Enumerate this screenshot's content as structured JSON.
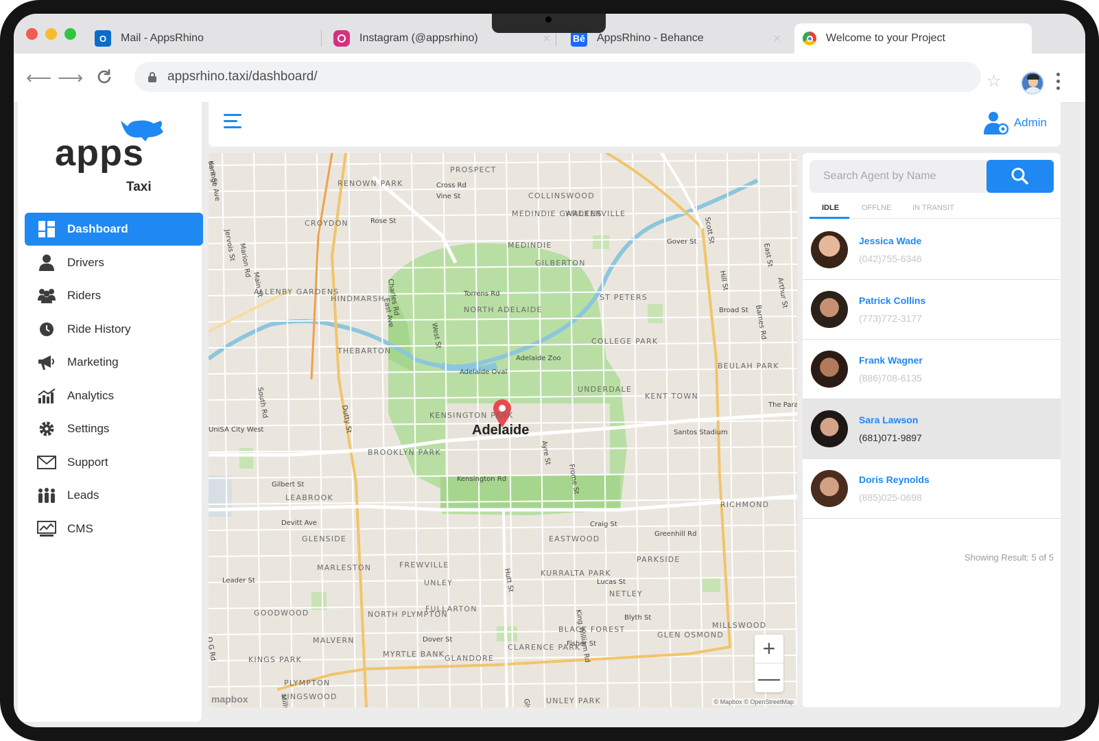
{
  "browser": {
    "tabs": [
      {
        "label": "Mail - AppsRhino",
        "icon": "outlook-icon"
      },
      {
        "label": "Instagram (@appsrhino)",
        "icon": "instagram-icon"
      },
      {
        "label": "AppsRhino - Behance",
        "icon": "behance-icon"
      },
      {
        "label": "Welcome to your Project",
        "icon": "chrome-icon"
      }
    ],
    "url": "appsrhino.taxi/dashboard/"
  },
  "brand": {
    "name": "apps",
    "product": "Taxi",
    "color": "#1f88f2"
  },
  "sidebar": {
    "items": [
      {
        "label": "Dashboard",
        "icon": "dashboard-icon",
        "active": true
      },
      {
        "label": "Drivers",
        "icon": "driver-icon"
      },
      {
        "label": "Riders",
        "icon": "riders-icon"
      },
      {
        "label": "Ride History",
        "icon": "clock-icon"
      },
      {
        "label": "Marketing",
        "icon": "megaphone-icon"
      },
      {
        "label": "Analytics",
        "icon": "analytics-icon"
      },
      {
        "label": "Settings",
        "icon": "gear-icon"
      },
      {
        "label": "Support",
        "icon": "mail-icon"
      },
      {
        "label": "Leads",
        "icon": "leads-icon"
      },
      {
        "label": "CMS",
        "icon": "cms-icon"
      }
    ]
  },
  "header": {
    "user_label": "Admin"
  },
  "map": {
    "city": "Adelaide",
    "attribution": "© Mapbox © OpenStreetMap",
    "provider": "mapbox",
    "labels": [
      "PROSPECT",
      "RENOWN PARK",
      "COLLINSWOOD",
      "CROYDON",
      "MEDINDIE GARDENS",
      "WALKERVILLE",
      "MEDINDIE",
      "GILBERTON",
      "ALLENBY GARDENS",
      "HINDMARSH",
      "NORTH ADELAIDE",
      "ST PETERS",
      "THEBARTON",
      "COLLEGE PARK",
      "Adelaide Zoo",
      "Adelaide Oval",
      "BEULAH PARK",
      "UNDERDALE",
      "KENT TOWN",
      "The Parade",
      "KENSINGTON PARK",
      "UniSA City West",
      "BROOKLYN PARK",
      "Santos Stadium",
      "Kensington Rd",
      "LEABROOK",
      "Gilbert St",
      "RICHMOND",
      "Craig St",
      "Greenhill Rd",
      "EASTWOOD",
      "GLENSIDE",
      "PARKSIDE",
      "MARLESTON",
      "FREWVILLE",
      "KURRALTA PARK",
      "Leader St",
      "UNLEY",
      "NETLEY",
      "GOODWOOD",
      "FULLARTON",
      "NORTH PLYMPTON",
      "MILLSWOOD",
      "BLACK FOREST",
      "GLEN OSMOND",
      "MALVERN",
      "MYRTLE BANK",
      "GLANDORE",
      "CLARENCE PARK",
      "KINGS PARK",
      "UNLEY PARK",
      "PLYMPTON",
      "KINGSWOOD",
      "Cross Rd",
      "Vine St",
      "Rose St",
      "Torrens Rd",
      "Gover St",
      "Broad St",
      "Devitt Ave",
      "Lucas St",
      "Blyth St",
      "Fisher St",
      "Dover St",
      "Mills St",
      "Ayre St",
      "Frome St",
      "Hutt St",
      "King William Rd",
      "Dutty St",
      "South Rd",
      "Marion Rd",
      "Jervois St",
      "Main St",
      "Charles Rd",
      "East Ave",
      "West St",
      "East St",
      "Hill St",
      "Barnes Rd",
      "Arthur St",
      "Gage St",
      "Scott St",
      "Glynburn Rd",
      "O G Rd",
      "Kent St",
      "oaringe Ave"
    ]
  },
  "agents": {
    "search_placeholder": "Search Agent by Name",
    "tabs": [
      "IDLE",
      "OFFLNE",
      "IN TRANSIT"
    ],
    "list": [
      {
        "name": "Jessica Wade",
        "phone": "(042)755-6346"
      },
      {
        "name": "Patrick Collins",
        "phone": "(773)772-3177"
      },
      {
        "name": "Frank Wagner",
        "phone": "(886)708-6135"
      },
      {
        "name": "Sara Lawson",
        "phone": "(681)071-9897",
        "selected": true
      },
      {
        "name": "Doris Reynolds",
        "phone": "(885)025-0698"
      }
    ],
    "result_text": "Showing Result: 5 of 5"
  }
}
